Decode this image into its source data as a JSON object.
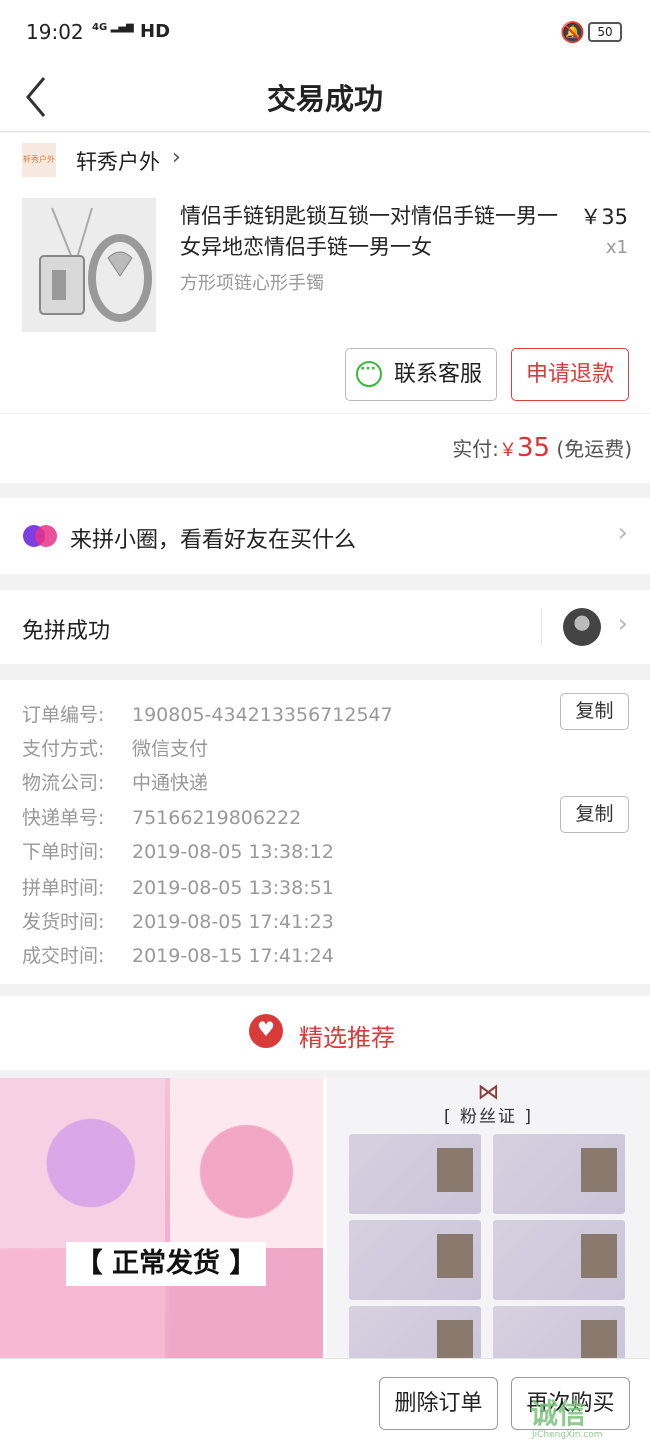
{
  "status_bar": {
    "time": "19:02",
    "network": "HD",
    "battery": "50"
  },
  "header": {
    "title": "交易成功"
  },
  "shop": {
    "logo_text": "轩秀户外",
    "name": "轩秀户外"
  },
  "product": {
    "title": "情侣手链钥匙锁互锁一对情侣手链一男一女异地恋情侣手链一男一女",
    "sku": "方形项链心形手镯",
    "price": "￥35",
    "qty": "x1"
  },
  "actions": {
    "contact_label": "联系客服",
    "refund_label": "申请退款"
  },
  "payment": {
    "label": "实付:",
    "currency": "￥",
    "amount": "35",
    "note": "(免运费)"
  },
  "circle": {
    "text": "来拼小圈，看看好友在买什么"
  },
  "group": {
    "text": "免拼成功"
  },
  "order_info": {
    "rows": [
      {
        "key": "订单编号:",
        "value": "190805-434213356712547"
      },
      {
        "key": "支付方式:",
        "value": "微信支付"
      },
      {
        "key": "物流公司:",
        "value": "中通快递"
      },
      {
        "key": "快递单号:",
        "value": "75166219806222"
      },
      {
        "key": "下单时间:",
        "value": "2019-08-05 13:38:12"
      },
      {
        "key": "拼单时间:",
        "value": "2019-08-05 13:38:51"
      },
      {
        "key": "发货时间:",
        "value": "2019-08-05 17:41:23"
      },
      {
        "key": "成交时间:",
        "value": "2019-08-15 17:41:24"
      }
    ],
    "copy_label": "复制"
  },
  "recommend": {
    "title": "精选推荐",
    "item1_banner": "【 正常发货 】",
    "item2_caption": "[ 粉丝证 ]"
  },
  "footer": {
    "delete_label": "删除订单",
    "rebuy_label": "再次购买"
  },
  "watermark": {
    "text": "诚信",
    "sub": "JiChengXin.com"
  },
  "colors": {
    "accent_red": "#d93a3a",
    "wechat_green": "#3bb83b"
  }
}
